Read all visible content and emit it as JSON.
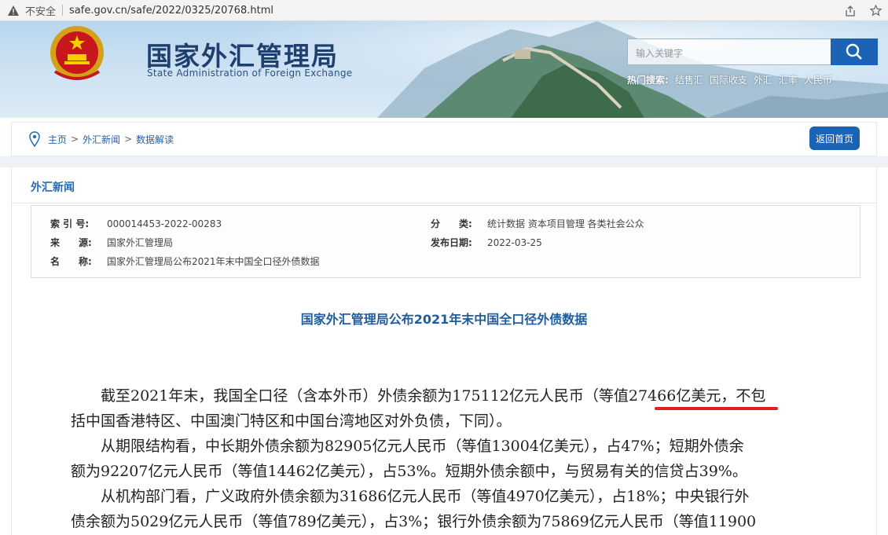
{
  "browser": {
    "security_label": "不安全",
    "url": "safe.gov.cn/safe/2022/0325/20768.html"
  },
  "header": {
    "logo_cn": "国家外汇管理局",
    "logo_en": "State Administration of Foreign Exchange",
    "search_placeholder": "输入关键字",
    "hot_label": "热门搜索:",
    "hot_items": [
      "结售汇",
      "国际收支",
      "外汇",
      "汇率",
      "人民币"
    ]
  },
  "breadcrumb": {
    "items": [
      "主页",
      "外汇新闻",
      "数据解读"
    ],
    "home_button": "返回首页"
  },
  "section": {
    "title": "外汇新闻"
  },
  "meta": {
    "index_key": "索 引 号:",
    "index_value": "000014453-2022-00283",
    "source_key": "来　　源:",
    "source_value": "国家外汇管理局",
    "name_key": "名　　称:",
    "name_value": "国家外汇管理局公布2021年末中国全口径外债数据",
    "category_key": "分　　类:",
    "category_value": "统计数据  资本项目管理  各类社会公众",
    "date_key": "发布日期:",
    "date_value": "2022-03-25"
  },
  "article": {
    "title": "国家外汇管理局公布2021年末中国全口径外债数据",
    "lines": [
      "　　截至2021年末，我国全口径（含本外币）外债余额为175112亿元人民币（等值27466亿美元，不包",
      "括中国香港特区、中国澳门特区和中国台湾地区对外负债，下同）。",
      "　　从期限结构看，中长期外债余额为82905亿元人民币（等值13004亿美元），占47%；短期外债余",
      "额为92207亿元人民币（等值14462亿美元），占53%。短期外债余额中，与贸易有关的信贷占39%。",
      "　　从机构部门看，广义政府外债余额为31686亿元人民币（等值4970亿美元），占18%；中央银行外",
      "债余额为5029亿元人民币（等值789亿美元），占3%；银行外债余额为75869亿元人民币（等值11900"
    ]
  },
  "colors": {
    "primary_blue": "#1b63b5",
    "title_blue": "#1e5d9e",
    "highlight_red": "#e02020"
  }
}
